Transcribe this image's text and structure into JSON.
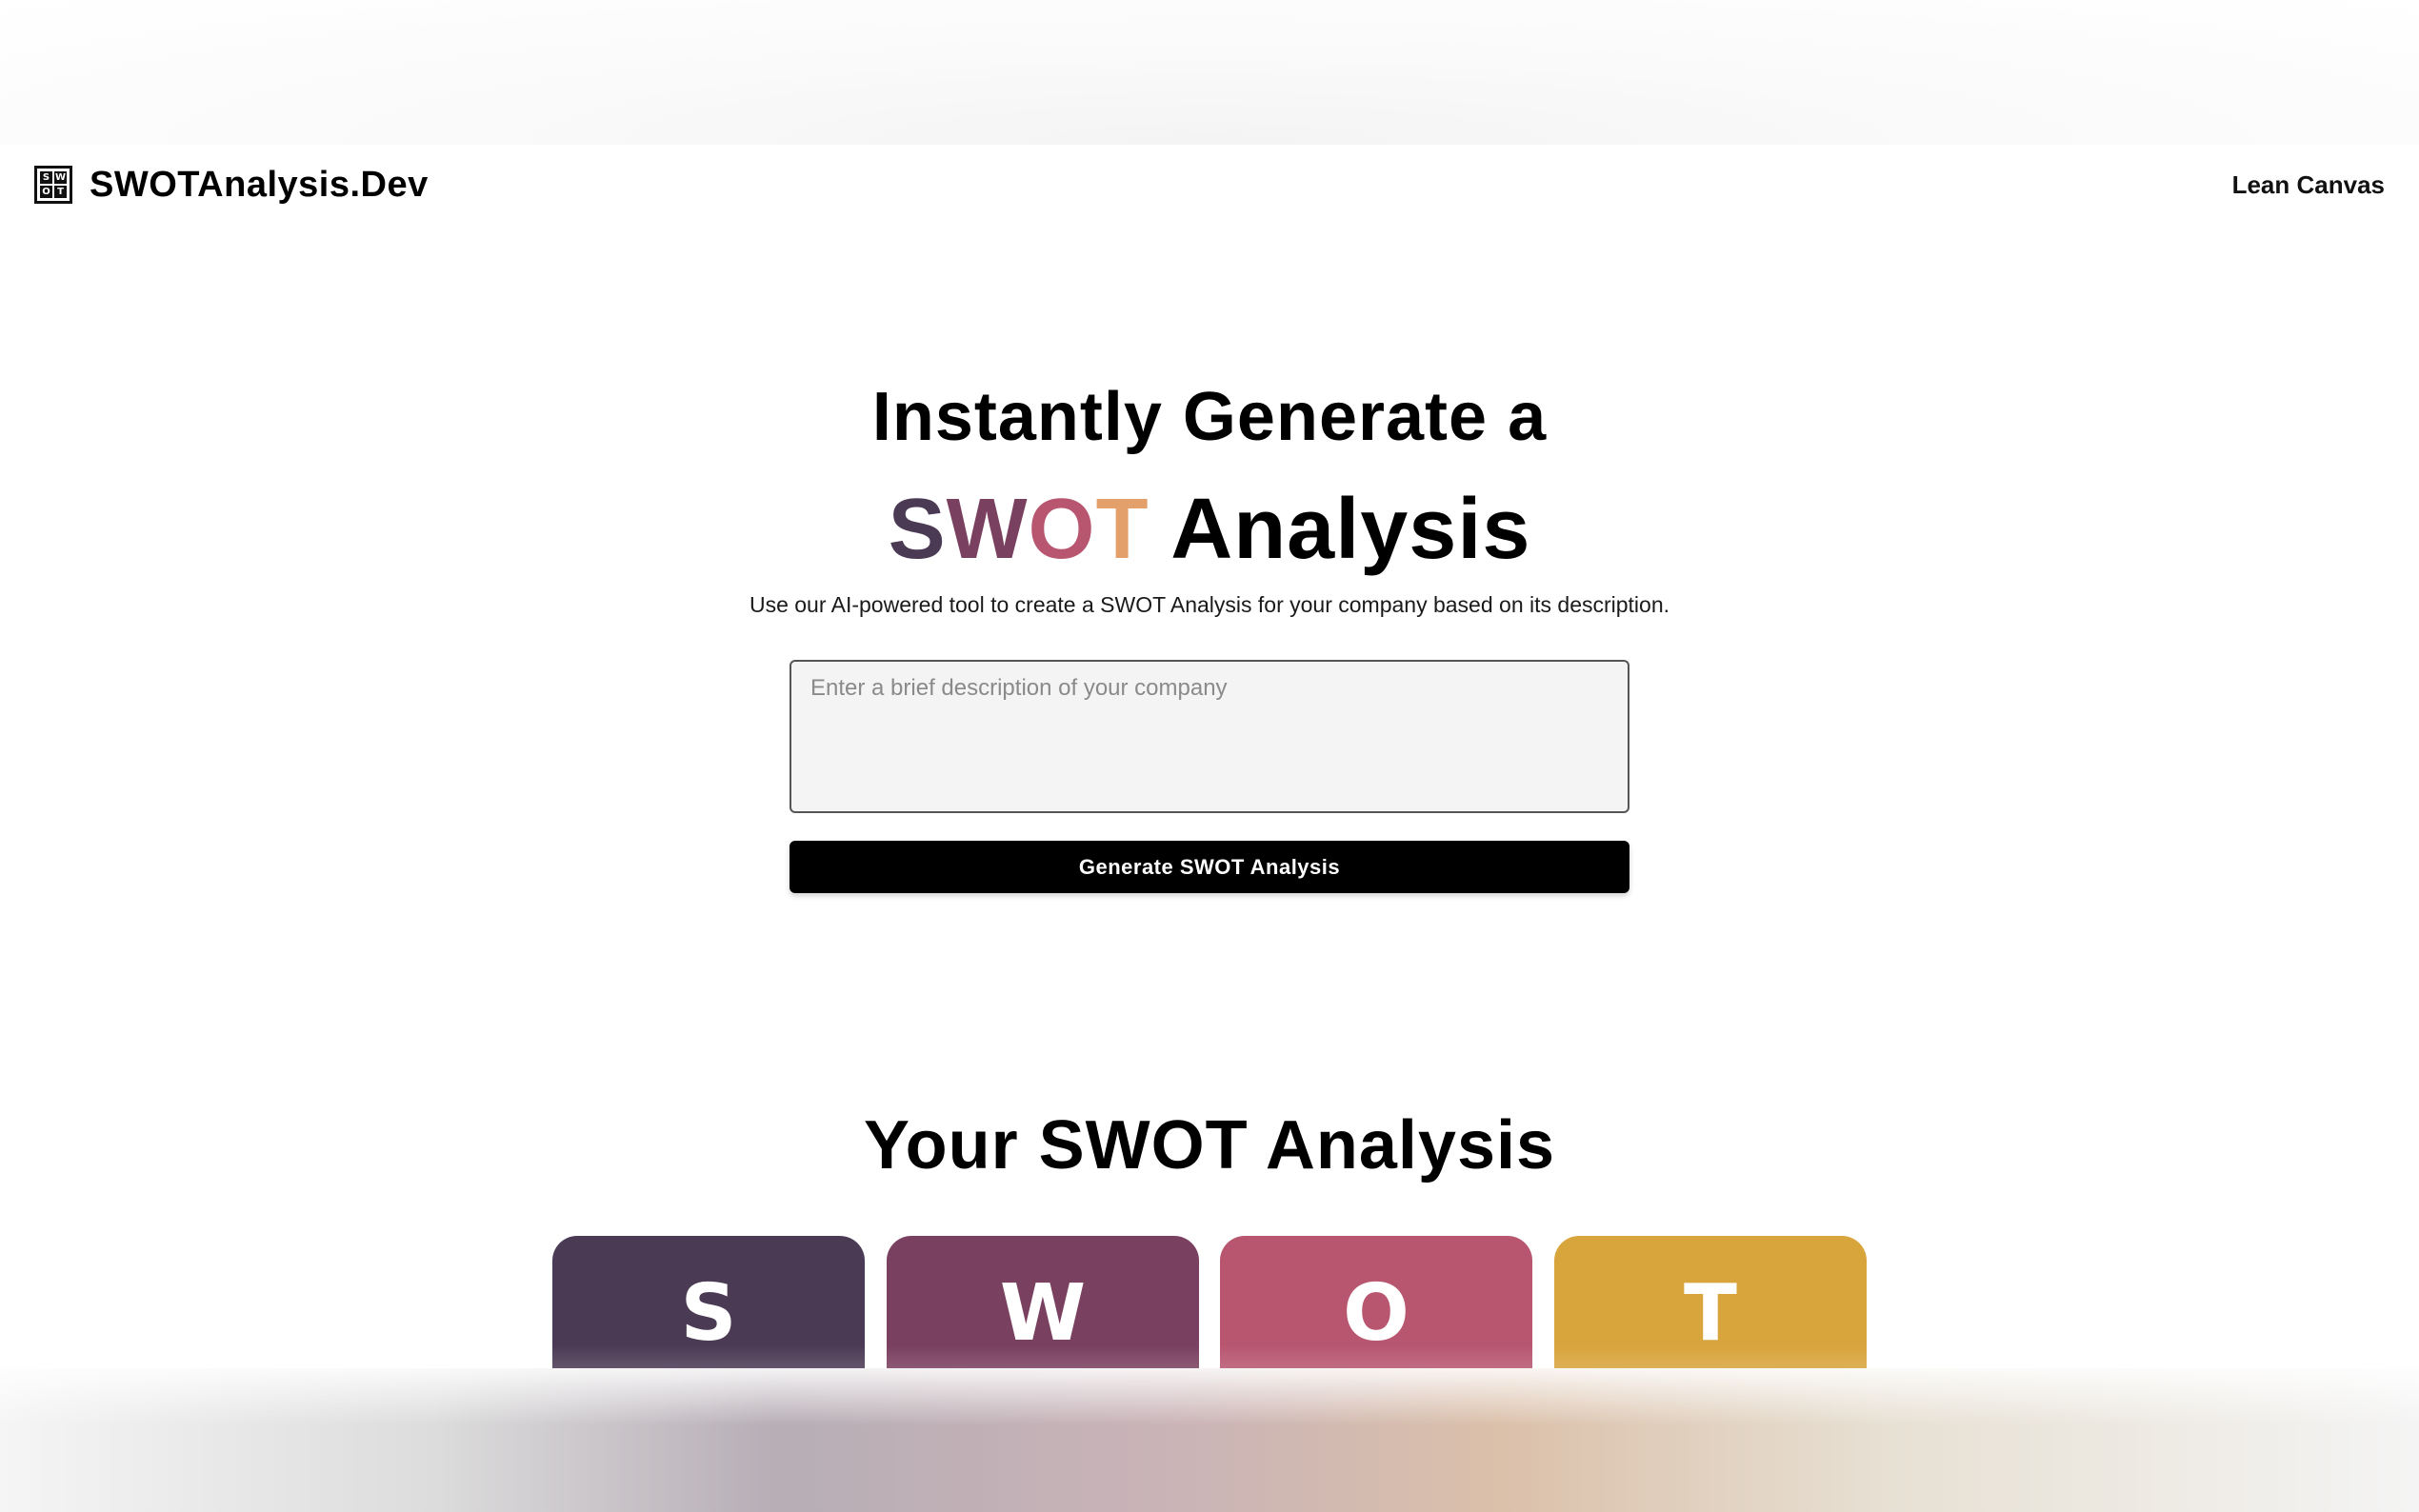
{
  "header": {
    "logo_letters": [
      "S",
      "W",
      "O",
      "T"
    ],
    "brand_name": "SWOTAnalysis.Dev",
    "nav_link": "Lean Canvas"
  },
  "hero": {
    "line1": "Instantly Generate a",
    "swot_letters": [
      "S",
      "W",
      "O",
      "T"
    ],
    "line2_rest": " Analysis",
    "subtitle": "Use our AI-powered tool to create a SWOT Analysis for your company based on its description.",
    "input_placeholder": "Enter a brief description of your company",
    "input_value": "",
    "button_label": "Generate SWOT Analysis"
  },
  "results": {
    "title": "Your SWOT Analysis",
    "cards": [
      {
        "letter": "S",
        "color": "#4b3a54"
      },
      {
        "letter": "W",
        "color": "#7a4060"
      },
      {
        "letter": "O",
        "color": "#b85670"
      },
      {
        "letter": "T",
        "color": "#d8a43c"
      }
    ]
  },
  "colors": {
    "s_accent": "#4b3a54",
    "w_accent": "#7a4060",
    "o_accent": "#b85670",
    "t_accent_heading": "#e3a06a",
    "button_bg": "#000000"
  }
}
